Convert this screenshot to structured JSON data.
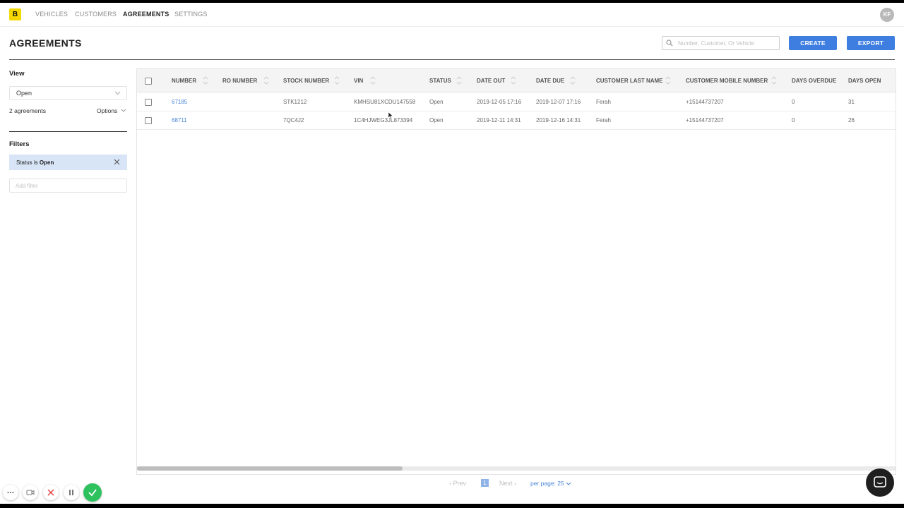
{
  "nav": {
    "logo_letter": "B",
    "items": [
      "VEHICLES",
      "CUSTOMERS",
      "AGREEMENTS",
      "SETTINGS"
    ],
    "active": "AGREEMENTS",
    "avatar_initials": "KF"
  },
  "header": {
    "title": "AGREEMENTS",
    "search_placeholder": "Number, Customer, Or Vehicle",
    "create_label": "CREATE",
    "export_label": "EXPORT"
  },
  "sidebar": {
    "view_label": "View",
    "view_value": "Open",
    "count_text": "2 agreements",
    "options_label": "Options",
    "filters_label": "Filters",
    "filter_chip_prefix": "Status is ",
    "filter_chip_value": "Open",
    "add_filter_placeholder": "Add filter"
  },
  "table": {
    "columns": [
      "NUMBER",
      "RO NUMBER",
      "STOCK NUMBER",
      "VIN",
      "STATUS",
      "DATE OUT",
      "DATE DUE",
      "CUSTOMER LAST NAME",
      "CUSTOMER MOBILE NUMBER",
      "DAYS OVERDUE",
      "DAYS OPEN"
    ],
    "rows": [
      [
        "67185",
        "",
        "STK1212",
        "KMHSU81XCDU147558",
        "Open",
        "2019-12-05 17:16",
        "2019-12-07 17:16",
        "Ferah",
        "+15144737207",
        "0",
        "31"
      ],
      [
        "68711",
        "",
        "7QC4J2",
        "1C4HJWEG3JL873394",
        "Open",
        "2019-12-11 14:31",
        "2019-12-16 14:31",
        "Ferah",
        "+15144737207",
        "0",
        "26"
      ]
    ],
    "scroll_fraction": 0.35
  },
  "pagination": {
    "prev_label": "Prev",
    "current_page": "1",
    "next_label": "Next",
    "per_page_label": "per page: 25"
  },
  "colors": {
    "accent": "#3d7ee0",
    "logo": "#f5d800",
    "filter_chip": "#d7e5f7",
    "done_button": "#2ec25f"
  }
}
